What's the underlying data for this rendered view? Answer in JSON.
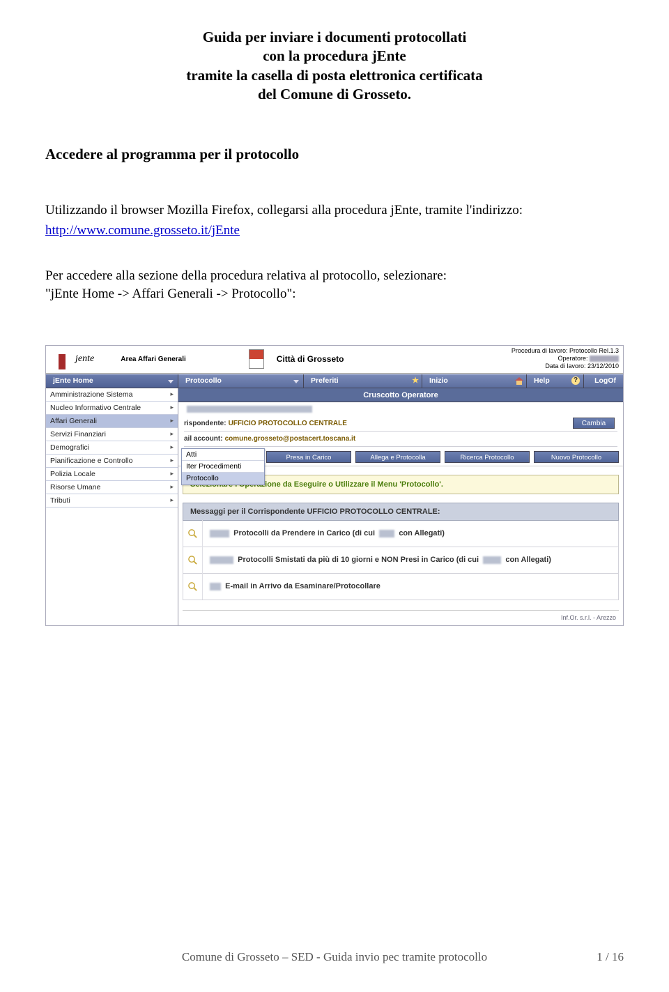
{
  "title_lines": [
    "Guida per inviare i documenti protocollati",
    "con la procedura jEnte",
    "tramite la casella di posta elettronica certificata",
    "del Comune di Grosseto."
  ],
  "section_heading": "Accedere al programma per il protocollo",
  "para1_a": "Utilizzando il browser Mozilla Firefox, collegarsi alla procedura jEnte, tramite l'indirizzo:",
  "para1_link": "http://www.comune.grosseto.it/jEnte",
  "para2_a": "Per accedere alla sezione della procedura relativa al protocollo, selezionare:",
  "para2_b": "\"jEnte Home -> Affari Generali -> Protocollo\":",
  "app": {
    "logo_text": "jente",
    "area": "Area Affari Generali",
    "city": "Città di Grosseto",
    "hdr_line1": "Procedura di lavoro: Protocollo Rel.1.3",
    "hdr_line2_label": "Operatore:",
    "hdr_line3": "Data di lavoro: 23/12/2010"
  },
  "menu": {
    "home": "jEnte Home",
    "protocollo": "Protocollo",
    "preferiti": "Preferiti",
    "inizio": "Inizio",
    "help": "Help",
    "logoff": "LogOf"
  },
  "sidebar": [
    "Amministrazione Sistema",
    "Nucleo Informativo Centrale",
    "Affari Generali",
    "Servizi Finanziari",
    "Demografici",
    "Pianificazione e Controllo",
    "Polizia Locale",
    "Risorse Umane",
    "Tributi"
  ],
  "submenu": [
    "Atti",
    "Iter Procedimenti",
    "Protocollo"
  ],
  "main": {
    "cruscotto": "Cruscotto Operatore",
    "risp_label": "rispondente:",
    "risp_val": "UFFICIO PROTOCOLLO CENTRALE",
    "mail_label": "ail account:",
    "mail_val": "comune.grosseto@postacert.toscana.it",
    "cambia": "Cambia",
    "buttons": [
      "Presa in Carico",
      "Allega e Protocolla",
      "Ricerca Protocollo",
      "Nuovo Protocollo"
    ],
    "yellow": "Selezionare l'Operazione da Eseguire o Utilizzare il Menu 'Protocollo'.",
    "msg_head": "Messaggi per il Corrispondente UFFICIO PROTOCOLLO CENTRALE:",
    "msg1_a": "Protocolli da Prendere in Carico  (di cui",
    "msg1_b": "con Allegati)",
    "msg2_a": "Protocolli Smistati da più di 10 giorni e NON Presi in Carico  (di cui",
    "msg2_b": "con Allegati)",
    "msg3": "E-mail in Arrivo da Esaminare/Protocollare",
    "app_footer": "Inf.Or. s.r.l. - Arezzo"
  },
  "footer": {
    "text": "Comune di Grosseto – SED - Guida invio pec tramite protocollo",
    "page": "1 / 16"
  }
}
